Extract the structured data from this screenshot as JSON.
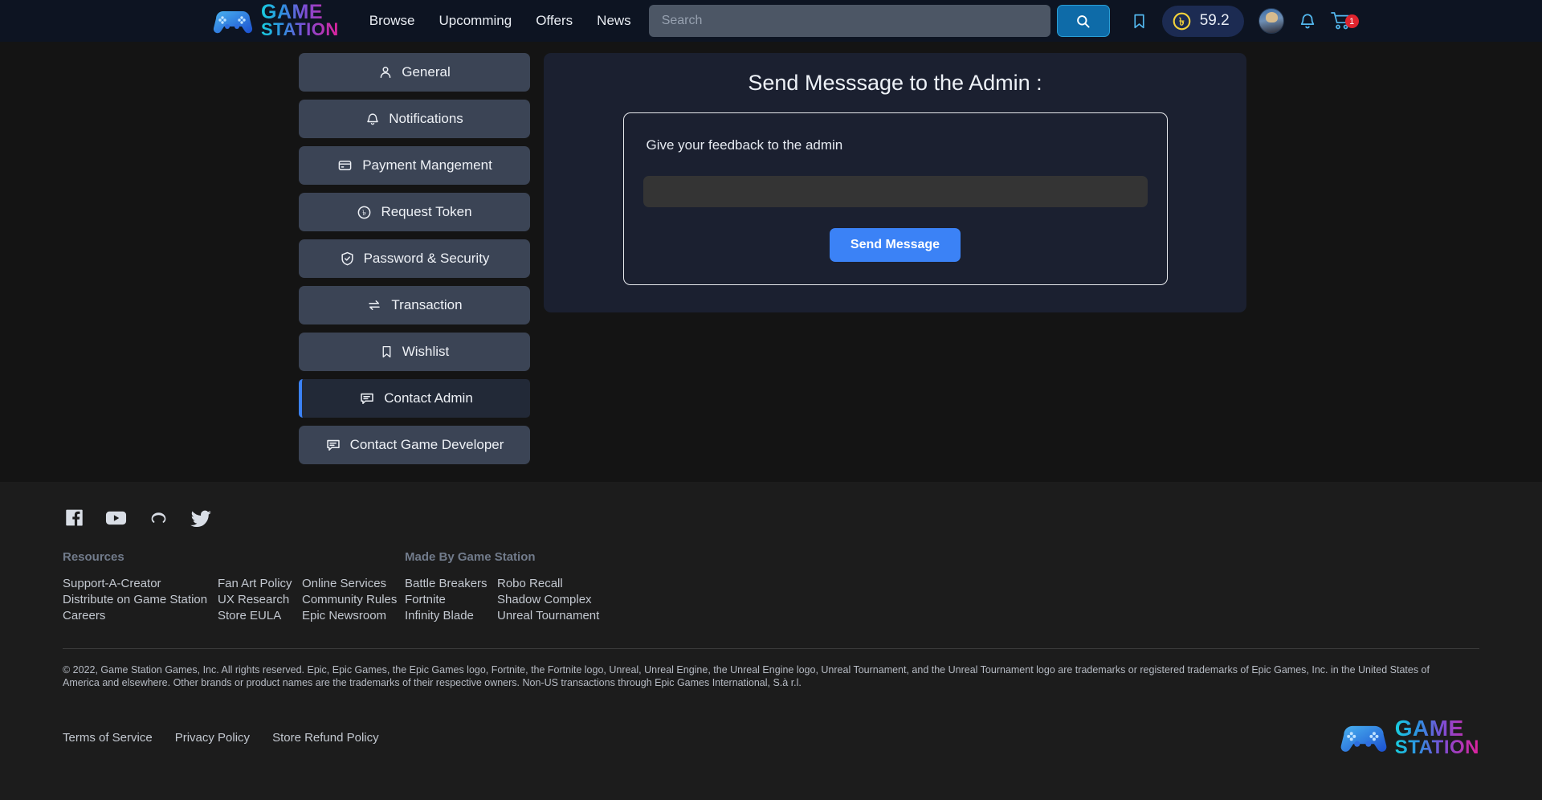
{
  "brand": {
    "line1": "GAME",
    "line2": "STATION",
    "gradient_from": "#18cfe0",
    "gradient_to": "#e0219b"
  },
  "header": {
    "nav": [
      {
        "label": "Browse"
      },
      {
        "label": "Upcomming"
      },
      {
        "label": "Offers"
      },
      {
        "label": "News"
      }
    ],
    "search": {
      "value": "",
      "placeholder": "Search"
    },
    "search_button_icon": "search-icon",
    "bookmark_icon": "bookmark-icon",
    "coin": {
      "symbol": "৳",
      "amount": "59.2",
      "color": "#f5d33a"
    },
    "bell_icon": "bell-icon",
    "cart_icon": "cart-icon",
    "cart_badge": "1",
    "accent": "#3b82f6"
  },
  "sidebar": {
    "items": [
      {
        "label": "General",
        "icon": "user-icon",
        "active": false
      },
      {
        "label": "Notifications",
        "icon": "bell-icon",
        "active": false
      },
      {
        "label": "Payment Mangement",
        "icon": "credit-card-icon",
        "active": false
      },
      {
        "label": "Request Token",
        "icon": "token-coin-icon",
        "active": false
      },
      {
        "label": "Password & Security",
        "icon": "shield-check-icon",
        "active": false
      },
      {
        "label": "Transaction",
        "icon": "transfer-arrows-icon",
        "active": false
      },
      {
        "label": "Wishlist",
        "icon": "bookmark-icon",
        "active": false
      },
      {
        "label": "Contact Admin",
        "icon": "chat-icon",
        "active": true
      },
      {
        "label": "Contact Game Developer",
        "icon": "chat-icon",
        "active": false
      }
    ]
  },
  "main": {
    "title": "Send Messsage to the Admin :",
    "feedback_label": "Give your feedback to the admin",
    "message": {
      "value": "",
      "placeholder": ""
    },
    "send_button": "Send Message"
  },
  "footer": {
    "socials": [
      {
        "name": "facebook-icon"
      },
      {
        "name": "youtube-icon"
      },
      {
        "name": "discord-icon"
      },
      {
        "name": "twitter-icon"
      }
    ],
    "resources_heading": "Resources",
    "made_by_heading": "Made By Game Station",
    "columns": [
      {
        "links": [
          "Support-A-Creator",
          "Distribute on Game Station",
          "Careers"
        ]
      },
      {
        "links": [
          "Fan Art Policy",
          "UX Research",
          "Store EULA"
        ]
      },
      {
        "links": [
          "Online Services",
          "Community Rules",
          "Epic Newsroom"
        ]
      },
      {
        "links": [
          "Battle Breakers",
          "Fortnite",
          "Infinity Blade"
        ]
      },
      {
        "links": [
          "Robo Recall",
          "Shadow Complex",
          "Unreal Tournament"
        ]
      }
    ],
    "legal": "© 2022, Game Station Games, Inc. All rights reserved. Epic, Epic Games, the Epic Games logo, Fortnite, the Fortnite logo, Unreal, Unreal Engine, the Unreal Engine logo, Unreal Tournament, and the Unreal Tournament logo are trademarks or registered trademarks of Epic Games, Inc. in the United States of America and elsewhere. Other brands or product names are the trademarks of their respective owners. Non-US transactions through Epic Games International, S.à r.l.",
    "bottom_links": [
      "Terms of Service",
      "Privacy Policy",
      "Store Refund Policy"
    ]
  }
}
